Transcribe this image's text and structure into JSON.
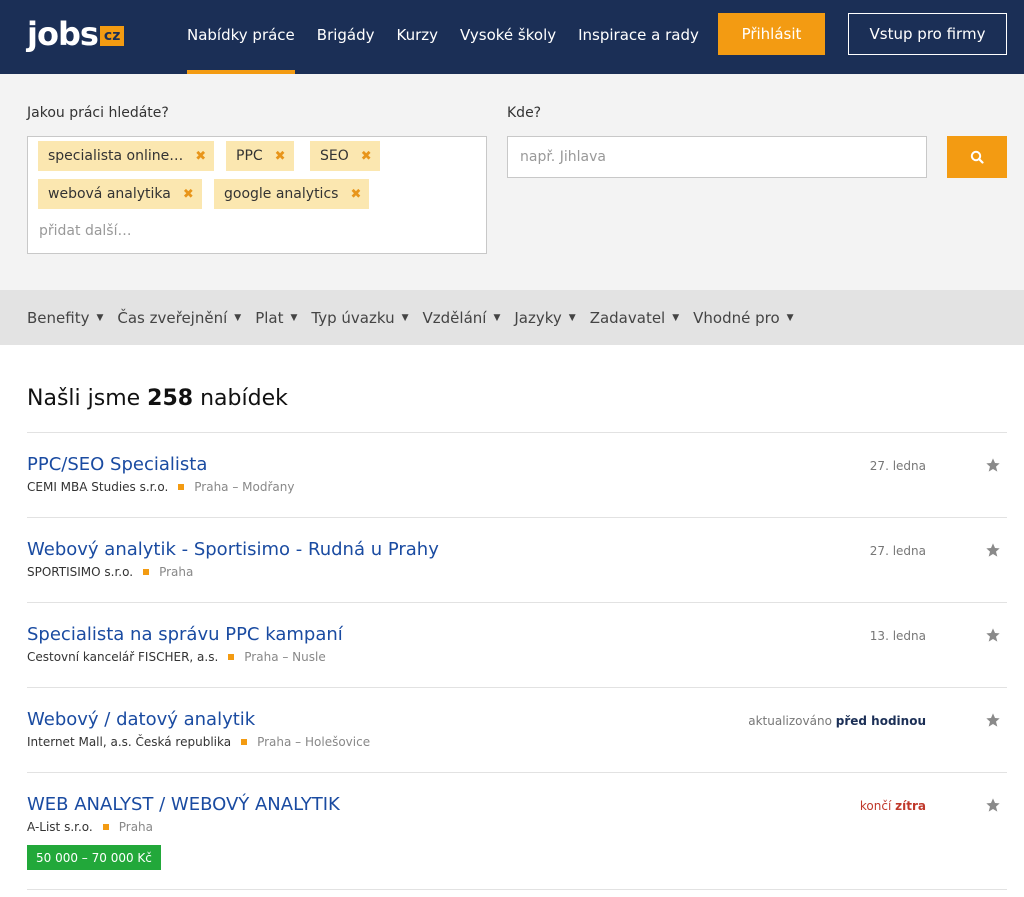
{
  "header": {
    "logo_text": "jobs",
    "logo_badge": "cz",
    "nav": [
      "Nabídky práce",
      "Brigády",
      "Kurzy",
      "Vysoké školy",
      "Inspirace a rady"
    ],
    "login_label": "Přihlásit",
    "firms_label": "Vstup pro firmy"
  },
  "search": {
    "what_label": "Jakou práci hledáte?",
    "where_label": "Kde?",
    "tags": [
      "specialista online…",
      "PPC",
      "SEO",
      "webová analytika",
      "google analytics"
    ],
    "add_more": "přidat další…",
    "where_placeholder": "např. Jihlava"
  },
  "filters": [
    "Benefity",
    "Čas zveřejnění",
    "Plat",
    "Typ úvazku",
    "Vzdělání",
    "Jazyky",
    "Zadavatel",
    "Vhodné pro"
  ],
  "results": {
    "prefix": "Našli jsme",
    "count": "258",
    "suffix": "nabídek"
  },
  "jobs": [
    {
      "title": "PPC/SEO Specialista",
      "company": "CEMI MBA Studies s.r.o.",
      "location": "Praha – Modřany",
      "date": "27. ledna"
    },
    {
      "title": "Webový analytik - Sportisimo - Rudná u Prahy",
      "company": "SPORTISIMO s.r.o.",
      "location": "Praha",
      "date": "27. ledna"
    },
    {
      "title": "Specialista na správu PPC kampaní",
      "company": "Cestovní kancelář FISCHER, a.s.",
      "location": "Praha – Nusle",
      "date": "13. ledna"
    },
    {
      "title": "Webový / datový analytik",
      "company": "Internet Mall, a.s. Česká republika",
      "location": "Praha – Holešovice",
      "date_prefix": "aktualizováno",
      "date_bold": "před hodinou"
    },
    {
      "title": "WEB ANALYST / WEBOVÝ ANALYTIK",
      "company": "A-List s.r.o.",
      "location": "Praha",
      "date_prefix": "končí",
      "date_bold": "zítra",
      "salary": "50 000 – 70 000 Kč"
    }
  ],
  "colors": {
    "header_bg": "#1b2f56",
    "accent": "#f39b12",
    "link": "#1a4ba1",
    "salary_bg": "#22a83a",
    "ending": "#c0392b"
  }
}
